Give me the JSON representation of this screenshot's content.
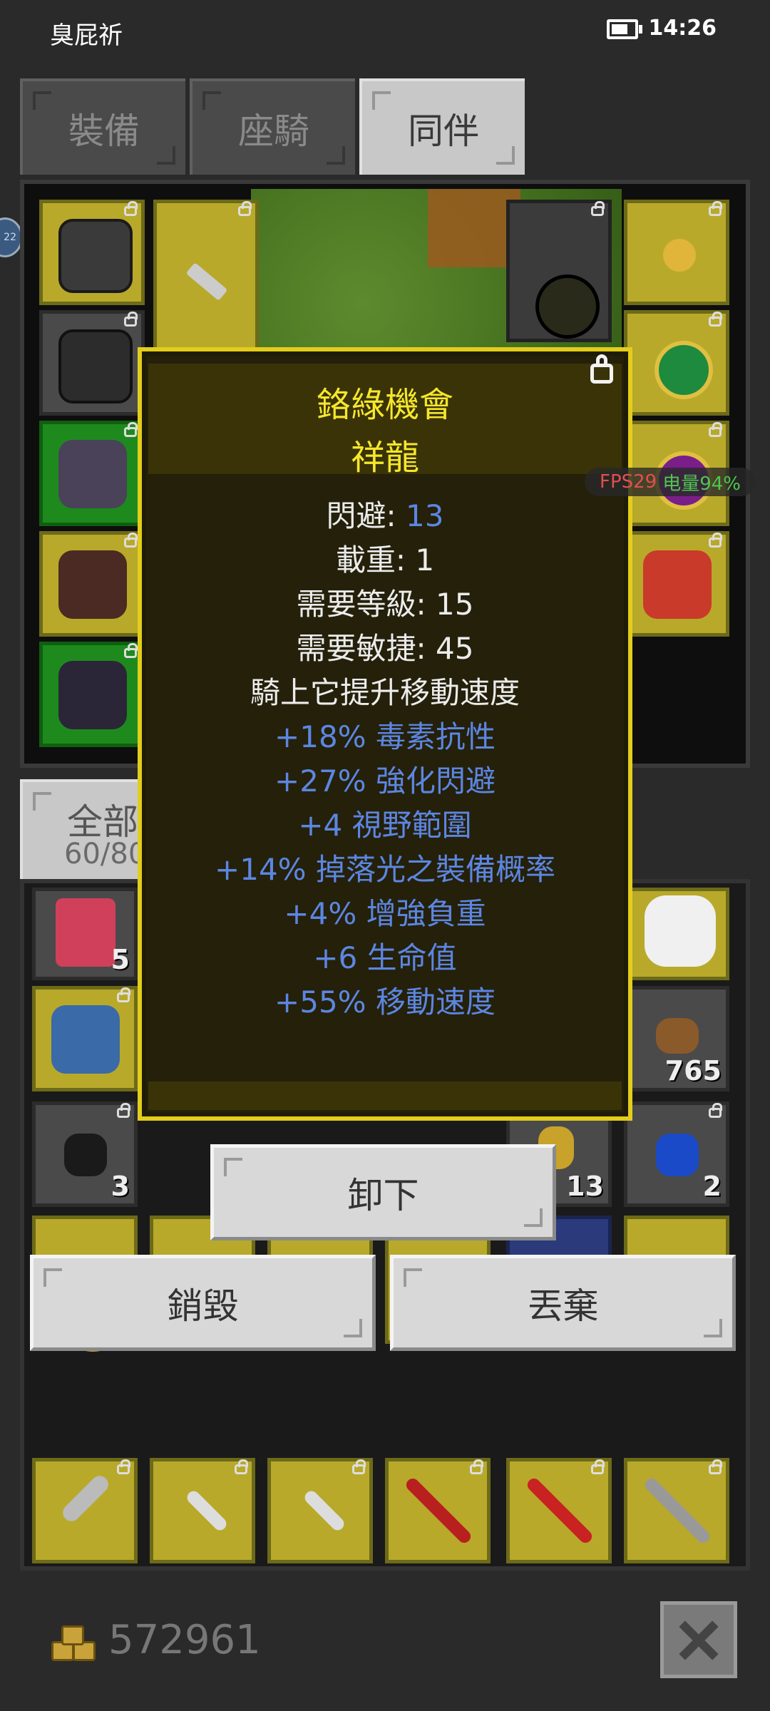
{
  "status_bar": {
    "app_name": "臭屁祈",
    "time": "14:26"
  },
  "tabs": [
    {
      "label": "裝備"
    },
    {
      "label": "座騎"
    },
    {
      "label": "同伴"
    }
  ],
  "side_badge": "22",
  "filter": {
    "label": "全部",
    "count": "60/80"
  },
  "tooltip": {
    "title": "鉻綠機會",
    "subtitle": "祥龍",
    "stats": [
      {
        "label": "閃避: ",
        "value": "13"
      },
      {
        "label": "載重: 1"
      },
      {
        "label": "需要等級: 15"
      },
      {
        "label": "需要敏捷: 45"
      },
      {
        "label": "騎上它提升移動速度"
      }
    ],
    "bonuses": [
      "+18% 毒素抗性",
      "+27% 強化閃避",
      "+4 視野範圍",
      "+14% 掉落光之裝備概率",
      "+4% 增強負重",
      "+6 生命值",
      "+55% 移動速度"
    ]
  },
  "fps_overlay": {
    "fps": "FPS29",
    "battery": "电量94%"
  },
  "inventory_counts": [
    "5",
    "765",
    "3",
    "13",
    "2"
  ],
  "actions": {
    "unequip": "卸下",
    "destroy": "銷毀",
    "discard": "丟棄"
  },
  "gold": {
    "amount": "572961"
  },
  "colors": {
    "tooltip_border": "#e3cd1b",
    "title": "#f5e72c",
    "bonus_text": "#5c86e2",
    "slot_gold": "#b8a92a",
    "slot_green": "#1e8a1e"
  }
}
